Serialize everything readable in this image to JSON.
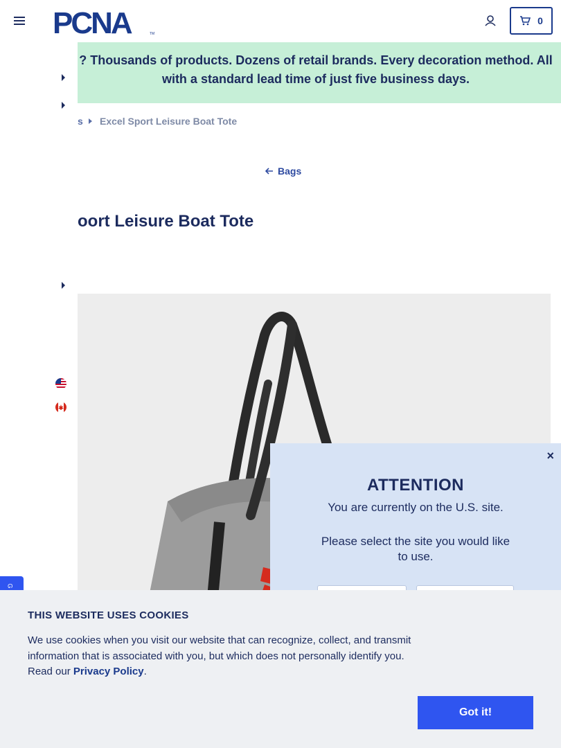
{
  "header": {
    "logo_text": "PCNA",
    "logo_tm": "TM",
    "cart_count": "0",
    "brand_color": "#1a3a8c"
  },
  "banner": {
    "text": "? Thousands of products. Dozens of retail brands. Every decoration method. All with a standard lead time of just five business days.",
    "background": "#c6efd7"
  },
  "breadcrumb": {
    "previous": "s",
    "current": "Excel Sport Leisure Boat Tote"
  },
  "back_link": {
    "label": "Bags"
  },
  "product": {
    "title": "oort Leisure Boat Tote"
  },
  "attention_modal": {
    "close": "×",
    "title": "ATTENTION",
    "current_site": "You are currently on the U.S. site.",
    "select_prompt": "Please select the site you would like to use."
  },
  "cookie_banner": {
    "title": "THIS WEBSITE USES COOKIES",
    "body": "We use cookies when you visit our website that can recognize, collect, and transmit information that is associated with you, but which does not personally identify you. Read our ",
    "link": "Privacy Policy",
    "after_link": ".",
    "button": "Got it!",
    "button_color": "#2f55f0"
  },
  "side_tab": {
    "label": "G"
  }
}
